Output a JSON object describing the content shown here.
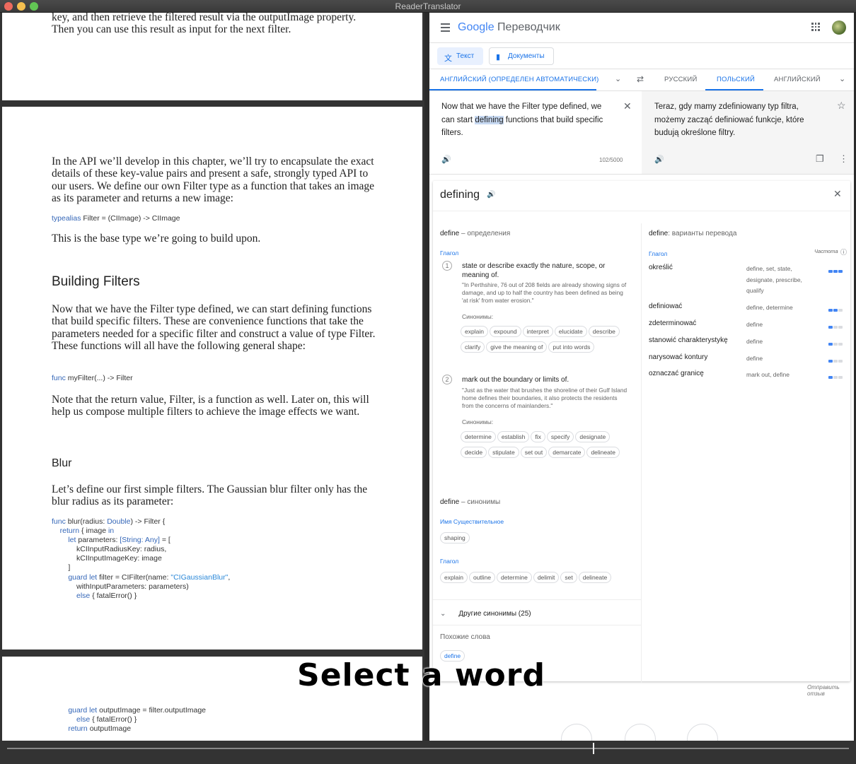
{
  "window": {
    "title": "ReaderTranslator"
  },
  "book": {
    "p0": "key, and then retrieve the filtered result via the outputImage property. Then you can use this result as input for the next filter.",
    "p1": "In the API we’ll develop in this chapter, we’ll try to encapsulate the exact details of these key-value pairs and present a safe, strongly typed API to our users. We define our own Filter type as a function that takes an image as its parameter and returns a new image:",
    "code1_kw": "typealias",
    "code1_rest": " Filter = (CIImage) -> CIImage",
    "p2": "This is the base type we’re going to build upon.",
    "h1": "Building Filters",
    "p3": "Now that we have the Filter type defined, we can start defining functions that build specific filters. These are convenience functions that take the parameters needed for a specific filter and construct a value of type Filter. These functions will all have the following general shape:",
    "code2_kw": "func",
    "code2_rest": " myFilter(...) -> Filter",
    "p4": "Note that the return value, Filter, is a function as well. Later on, this will help us compose multiple filters to achieve the image effects we want.",
    "h2": "Blur",
    "p5": "Let’s define our first simple filters. The Gaussian blur filter only has the blur radius as its parameter:",
    "code3": [
      {
        "kw": "func",
        "rest": " blur(radius: ",
        "kw2": "Double",
        "rest2": ") -> Filter {"
      },
      {
        "kw": "    return",
        "rest": " { image ",
        "kw2": "in",
        "rest2": ""
      },
      {
        "kw": "        let",
        "rest": " parameters: ",
        "kw2": "[String: Any]",
        "rest2": " = ["
      },
      {
        "kw": "",
        "rest": "            kCIInputRadiusKey: radius,",
        "kw2": "",
        "rest2": ""
      },
      {
        "kw": "",
        "rest": "            kCIInputImageKey: image",
        "kw2": "",
        "rest2": ""
      },
      {
        "kw": "",
        "rest": "        ]",
        "kw2": "",
        "rest2": ""
      },
      {
        "kw": "        guard let",
        "rest": " filter = CIFilter(name: ",
        "kw2": "\"CIGaussianBlur\"",
        "rest2": ","
      },
      {
        "kw": "",
        "rest": "            withInputParameters: parameters)",
        "kw2": "",
        "rest2": ""
      },
      {
        "kw": "            else",
        "rest": " { fatalError() }",
        "kw2": "",
        "rest2": ""
      }
    ],
    "code4": [
      {
        "kw": "        guard let",
        "rest": " outputImage = filter.outputImage"
      },
      {
        "kw": "            else",
        "rest": " { fatalError() }"
      },
      {
        "kw": "        return",
        "rest": " outputImage"
      }
    ]
  },
  "translator": {
    "logo_google": "Google",
    "logo_service": "Переводчик",
    "mode_text": "Текст",
    "mode_docs": "Документы",
    "src_lang_detected": "АНГЛИЙСКИЙ (ОПРЕДЕЛЕН АВТОМАТИЧЕСКИ)",
    "tgt_langs": [
      "РУССКИЙ",
      "ПОЛЬСКИЙ",
      "АНГЛИЙСКИЙ"
    ],
    "source_pre": "Now that we have the Filter type defined, we can start ",
    "source_hl": "defining",
    "source_post": " functions that build specific filters.",
    "char_count": "102/5000",
    "translation": "Teraz, gdy mamy zdefiniowany typ filtra, możemy zacząć definiować funkcje, które budują określone filtry."
  },
  "dictionary": {
    "word": "defining",
    "def_header_word": "define",
    "def_header_rest": " – определения",
    "pos_verb": "Глагол",
    "senses": [
      {
        "n": "1",
        "def": "state or describe exactly the nature, scope, or meaning of.",
        "ex": "\"In Perthshire, 76 out of 208 fields are already showing signs of damage, and up to half the country has been defined as being 'at risk' from water erosion.\"",
        "syn_label": "Синонимы:",
        "syns": [
          "explain",
          "expound",
          "interpret",
          "elucidate",
          "describe",
          "clarify",
          "give the meaning of",
          "put into words"
        ]
      },
      {
        "n": "2",
        "def": "mark out the boundary or limits of.",
        "ex": "\"Just as the water that brushes the shoreline of their Gulf Island home defines their boundaries, it also protects the residents from the concerns of mainlanders.\"",
        "syn_label": "Синонимы:",
        "syns": [
          "determine",
          "establish",
          "fix",
          "specify",
          "designate",
          "decide",
          "stipulate",
          "set out",
          "demarcate",
          "delineate"
        ]
      }
    ],
    "syn_header_word": "define",
    "syn_header_rest": " – синонимы",
    "pos_noun": "Имя Существительное",
    "noun_syns": [
      "shaping"
    ],
    "pos_verb2": "Глагол",
    "verb_syns": [
      "explain",
      "outline",
      "determine",
      "delimit",
      "set",
      "delineate"
    ],
    "more_syns": "Другие синонимы (25)",
    "similar_label": "Похожие слова",
    "similar": [
      "define"
    ],
    "trans_header_word": "define",
    "trans_header_rest": ": варианты перевода",
    "trans_pos": "Глагол",
    "freq_label": "Частота",
    "translations": [
      {
        "word": "określić",
        "back": "define, set, state, designate, prescribe, qualify",
        "freq": 3
      },
      {
        "word": "definiować",
        "back": "define, determine",
        "freq": 2
      },
      {
        "word": "zdeterminować",
        "back": "define",
        "freq": 1
      },
      {
        "word": "stanowić charakterystykę",
        "back": "define",
        "freq": 1
      },
      {
        "word": "narysować kontury",
        "back": "define",
        "freq": 1
      },
      {
        "word": "oznaczać granicę",
        "back": "mark out, define",
        "freq": 1
      }
    ],
    "feedback": "Отправить отзыв"
  },
  "overlay": {
    "caption": "Select a word"
  },
  "colors": {
    "accent": "#1a73e8",
    "highlight": "#c7d9f2"
  }
}
